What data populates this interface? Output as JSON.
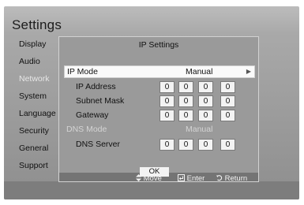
{
  "title": "Settings",
  "sidebar": {
    "items": [
      {
        "label": "Display"
      },
      {
        "label": "Audio"
      },
      {
        "label": "Network"
      },
      {
        "label": "System"
      },
      {
        "label": "Language"
      },
      {
        "label": "Security"
      },
      {
        "label": "General"
      },
      {
        "label": "Support"
      }
    ],
    "active": "Network"
  },
  "dialog": {
    "title": "IP Settings",
    "ip_mode": {
      "label": "IP Mode",
      "value": "Manual"
    },
    "ip_address": {
      "label": "IP Address",
      "octets": [
        "0",
        "0",
        "0",
        "0"
      ]
    },
    "subnet_mask": {
      "label": "Subnet Mask",
      "octets": [
        "0",
        "0",
        "0",
        "0"
      ]
    },
    "gateway": {
      "label": "Gateway",
      "octets": [
        "0",
        "0",
        "0",
        "0"
      ]
    },
    "dns_mode": {
      "label": "DNS Mode",
      "value": "Manual"
    },
    "dns_server": {
      "label": "DNS Server",
      "octets": [
        "0",
        "0",
        "0",
        "0"
      ]
    },
    "ok_label": "OK",
    "hints": {
      "move": "Move",
      "enter": "Enter",
      "return": "Return"
    }
  },
  "colors": {
    "screen_bg": "#a9a9a9",
    "dialog_bg": "#9a9a9a",
    "selected_row": "#fafafa",
    "disabled_text": "#d4d4d4"
  },
  "icons": {
    "move": "up-down-arrows-icon",
    "enter": "enter-icon",
    "return": "return-arrow-icon",
    "mode_arrow": "right-arrow-icon"
  }
}
